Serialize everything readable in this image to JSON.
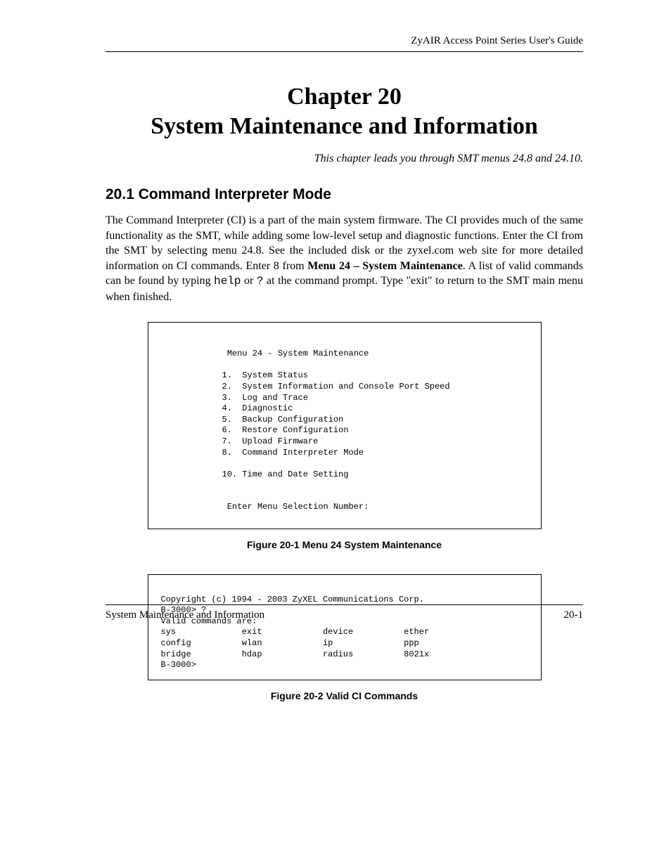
{
  "header": {
    "guide": "ZyAIR Access Point Series User's Guide"
  },
  "chapter": {
    "number": "Chapter 20",
    "title": "System Maintenance and Information",
    "intro": "This chapter leads you through SMT menus 24.8 and 24.10."
  },
  "section": {
    "heading": "20.1  Command Interpreter Mode",
    "para_1": "The Command Interpreter (CI) is a part of the main system firmware. The CI provides much of the same functionality as the SMT, while adding some low-level setup and diagnostic functions. Enter the CI from the SMT by selecting menu 24.8. See the included disk or the zyxel.com web site for more detailed information on CI commands. Enter 8 from ",
    "menu_bold": "Menu 24 – System Maintenance",
    "para_2": ". A list of valid commands can be found by typing ",
    "help_code": "help",
    "para_3": " or ",
    "q_code": "?",
    "para_4": " at the command prompt. Type \"exit\" to return to the SMT main menu when finished."
  },
  "figure1": {
    "title": " Menu 24 - System Maintenance",
    "items": [
      "1.  System Status",
      "2.  System Information and Console Port Speed",
      "3.  Log and Trace",
      "4.  Diagnostic",
      "5.  Backup Configuration",
      "6.  Restore Configuration",
      "7.  Upload Firmware",
      "8.  Command Interpreter Mode",
      "",
      "10. Time and Date Setting"
    ],
    "prompt": " Enter Menu Selection Number:",
    "caption": "Figure 20-1 Menu 24 System Maintenance"
  },
  "figure2": {
    "lines": [
      "Copyright (c) 1994 - 2003 ZyXEL Communications Corp.",
      "B-3000> ?",
      "Valid commands are:",
      "sys             exit            device          ether",
      "config          wlan            ip              ppp",
      "bridge          hdap            radius          8021x",
      "B-3000>"
    ],
    "caption": "Figure 20-2 Valid CI Commands"
  },
  "footer": {
    "left": "System Maintenance and Information",
    "right": "20-1"
  }
}
